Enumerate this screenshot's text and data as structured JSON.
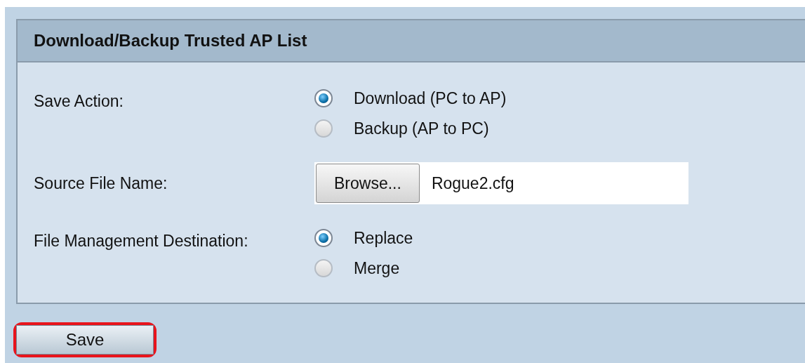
{
  "panel": {
    "title": "Download/Backup Trusted AP List",
    "fields": [
      {
        "kind": "radio",
        "label": "Save Action:",
        "options": [
          {
            "label": "Download (PC to AP)",
            "selected": true
          },
          {
            "label": "Backup (AP to PC)",
            "selected": false
          }
        ]
      },
      {
        "kind": "file",
        "label": "Source File Name:",
        "button": "Browse...",
        "value": "Rogue2.cfg"
      },
      {
        "kind": "radio",
        "label": "File Management Destination:",
        "options": [
          {
            "label": "Replace",
            "selected": true
          },
          {
            "label": "Merge",
            "selected": false
          }
        ]
      }
    ]
  },
  "save_button": {
    "label": "Save",
    "highlighted": true
  }
}
